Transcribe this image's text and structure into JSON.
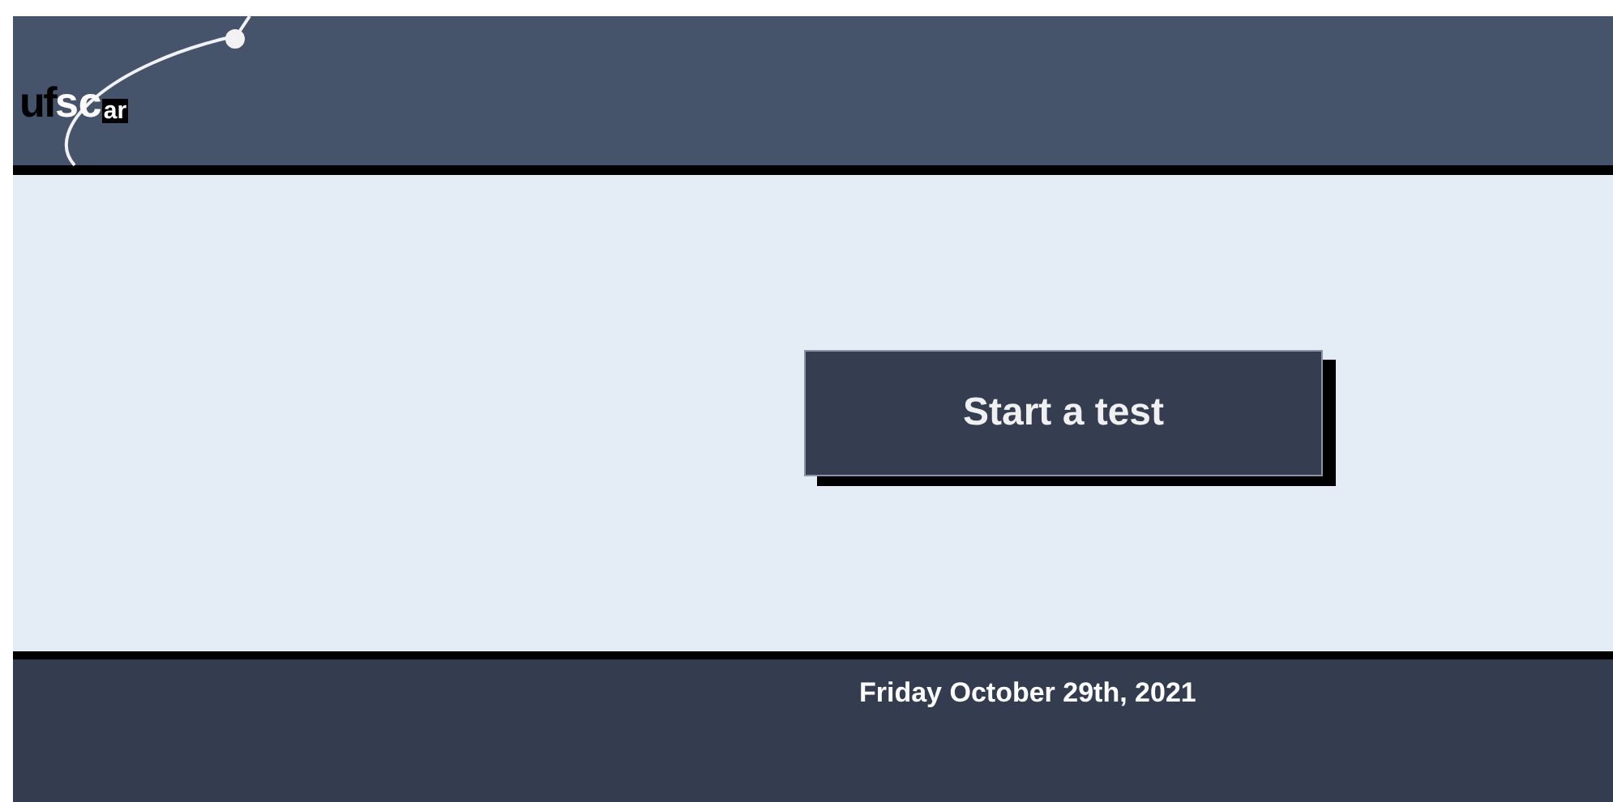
{
  "header": {
    "logo_parts": [
      "uf",
      "sc",
      "ar"
    ]
  },
  "main": {
    "button": "Start a test"
  },
  "footer": {
    "date": "Friday October 29th, 2021"
  }
}
